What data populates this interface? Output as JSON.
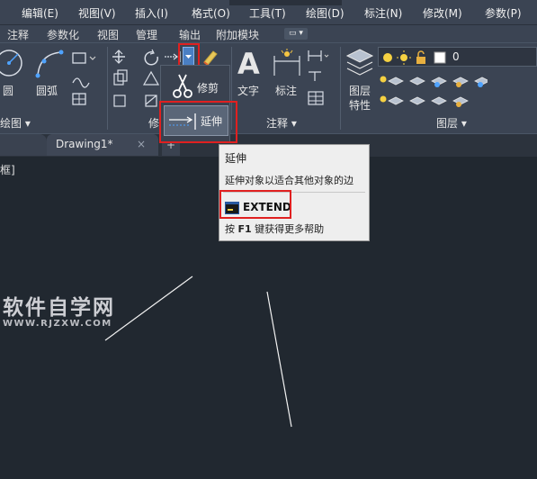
{
  "menu": {
    "items": [
      "编辑(E)",
      "视图(V)",
      "插入(I)",
      "格式(O)",
      "工具(T)",
      "绘图(D)",
      "标注(N)",
      "修改(M)",
      "参数(P)"
    ]
  },
  "ribbon_tabs": {
    "items": [
      "注释",
      "参数化",
      "视图",
      "管理",
      "输出",
      "附加模块"
    ],
    "toggle": "▭ ▾"
  },
  "ribbon": {
    "draw": {
      "circle_label": "圆",
      "arc_label": "圆弧",
      "panel_label": "绘图 ▾"
    },
    "modify": {
      "trim_label": "修剪",
      "panel_label": "修"
    },
    "annotation": {
      "text_label": "文字",
      "dimension_label": "标注",
      "panel_label": "注释 ▾"
    },
    "layers": {
      "layer_props_label_1": "图层",
      "layer_props_label_2": "特性",
      "current_layer": "0",
      "panel_label": "图层 ▾"
    }
  },
  "dropdown": {
    "extend_label": "延伸"
  },
  "doc_tabs": {
    "active": "Drawing1*",
    "close": "×",
    "add": "+"
  },
  "canvas": {
    "viewport_label": "框]"
  },
  "tooltip": {
    "title": "延伸",
    "description": "延伸对象以适合其他对象的边",
    "command": "EXTEND",
    "help_prefix": "按 ",
    "help_key": "F1",
    "help_suffix": " 键获得更多帮助"
  },
  "watermark": {
    "main": "软件自学网",
    "sub": "WWW.RJZXW.COM"
  },
  "colors": {
    "menubar": "#3b4453",
    "canvas": "#212830",
    "highlight": "#e02020",
    "tooltip_bg": "#eeeeee",
    "accent_blue": "#2a7fd4"
  }
}
